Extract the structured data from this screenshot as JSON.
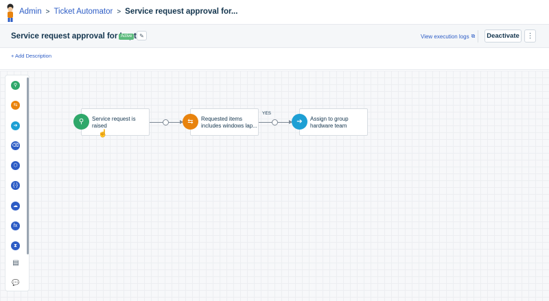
{
  "breadcrumb": {
    "items": [
      "Admin",
      "Ticket Automator"
    ],
    "current": "Service request approval for...",
    "separator": ">"
  },
  "header": {
    "title": "Service request approval for Laptop",
    "status": "Active",
    "execution_logs_label": "View execution logs",
    "deactivate_label": "Deactivate",
    "more_label": "⋮"
  },
  "description": {
    "add_label": "+ Add Description"
  },
  "palette": {
    "items": [
      {
        "name": "event-trigger-icon",
        "glyph": "⚲",
        "color": "#2fa86a"
      },
      {
        "name": "condition-icon",
        "glyph": "⇆",
        "color": "#e8830e"
      },
      {
        "name": "action-icon",
        "glyph": "➔",
        "color": "#1d9fd4"
      },
      {
        "name": "web-request-icon",
        "glyph": "⌫",
        "color": "#2c5cc5"
      },
      {
        "name": "app-icon",
        "glyph": "⬡",
        "color": "#2c5cc5"
      },
      {
        "name": "variable-icon",
        "glyph": "{·}",
        "color": "#2c5cc5"
      },
      {
        "name": "cloud-icon",
        "glyph": "☁",
        "color": "#2c5cc5"
      },
      {
        "name": "function-icon",
        "glyph": "fx",
        "color": "#2c5cc5"
      },
      {
        "name": "timer-icon",
        "glyph": "⧗",
        "color": "#2c5cc5"
      }
    ],
    "plain_items": [
      {
        "name": "document-icon",
        "glyph": "▤"
      },
      {
        "name": "chat-icon",
        "glyph": "💬"
      }
    ]
  },
  "workflow": {
    "nodes": [
      {
        "label_line1": "Service request is",
        "label_line2": "raised",
        "color": "#2fa86a",
        "glyph": "⚲"
      },
      {
        "label_line1": "Requested items",
        "label_line2": "includes windows lap...",
        "color": "#e8830e",
        "glyph": "⇆"
      },
      {
        "label_line1": "Assign to group",
        "label_line2": "hardware team",
        "color": "#1d9fd4",
        "glyph": "➔"
      }
    ],
    "branch_label": "YES"
  },
  "colors": {
    "link": "#2c5cc5",
    "text": "#12344d",
    "active_badge": "#5dbb7e"
  }
}
